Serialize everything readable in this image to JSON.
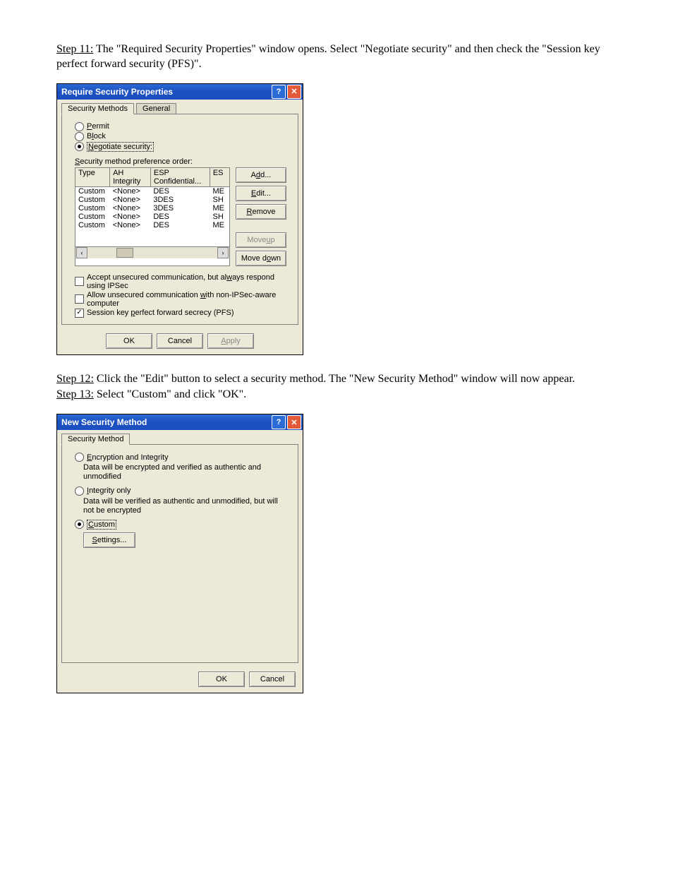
{
  "step11": {
    "label": "Step 11:",
    "text": "The \"Required Security Properties\" window opens. Select \"Negotiate security\" and then check the \"Session key perfect forward security (PFS)\"."
  },
  "win1": {
    "title": "Require Security Properties",
    "tab_active": "Security Methods",
    "tab_inactive": "General",
    "radio_permit": "Permit",
    "radio_block": "Block",
    "radio_negotiate": "Negotiate security:",
    "pref_label": "Security method preference order:",
    "cols": {
      "type": "Type",
      "ah": "AH Integrity",
      "esp": "ESP Confidential...",
      "es": "ES"
    },
    "rows": [
      {
        "type": "Custom",
        "ah": "<None>",
        "esp": "DES",
        "es": "ME"
      },
      {
        "type": "Custom",
        "ah": "<None>",
        "esp": "3DES",
        "es": "SH"
      },
      {
        "type": "Custom",
        "ah": "<None>",
        "esp": "3DES",
        "es": "ME"
      },
      {
        "type": "Custom",
        "ah": "<None>",
        "esp": "DES",
        "es": "SH"
      },
      {
        "type": "Custom",
        "ah": "<None>",
        "esp": "DES",
        "es": "ME"
      }
    ],
    "btn_add": "Add...",
    "btn_edit": "Edit...",
    "btn_remove": "Remove",
    "btn_moveup": "Move up",
    "btn_movedown": "Move down",
    "chk_accept": "Accept unsecured communication, but always respond using IPSec",
    "chk_allow": "Allow unsecured communication with non-IPSec-aware computer",
    "chk_pfs": "Session key perfect forward secrecy (PFS)",
    "btn_ok": "OK",
    "btn_cancel": "Cancel",
    "btn_apply": "Apply"
  },
  "step12": {
    "label": "Step 12:",
    "text": "Click the \"Edit\" button to select a security method. The \"New Security Method\" window will now appear."
  },
  "step13": {
    "label": "Step 13:",
    "text": "Select \"Custom\" and click \"OK\"."
  },
  "win2": {
    "title": "New Security Method",
    "tab": "Security Method",
    "opt_enc": "Encryption and Integrity",
    "opt_enc_desc": "Data will be encrypted and verified as authentic and unmodified",
    "opt_int": "Integrity only",
    "opt_int_desc": "Data will be verified as authentic and unmodified, but will not be encrypted",
    "opt_custom": "Custom",
    "btn_settings": "Settings...",
    "btn_ok": "OK",
    "btn_cancel": "Cancel"
  }
}
